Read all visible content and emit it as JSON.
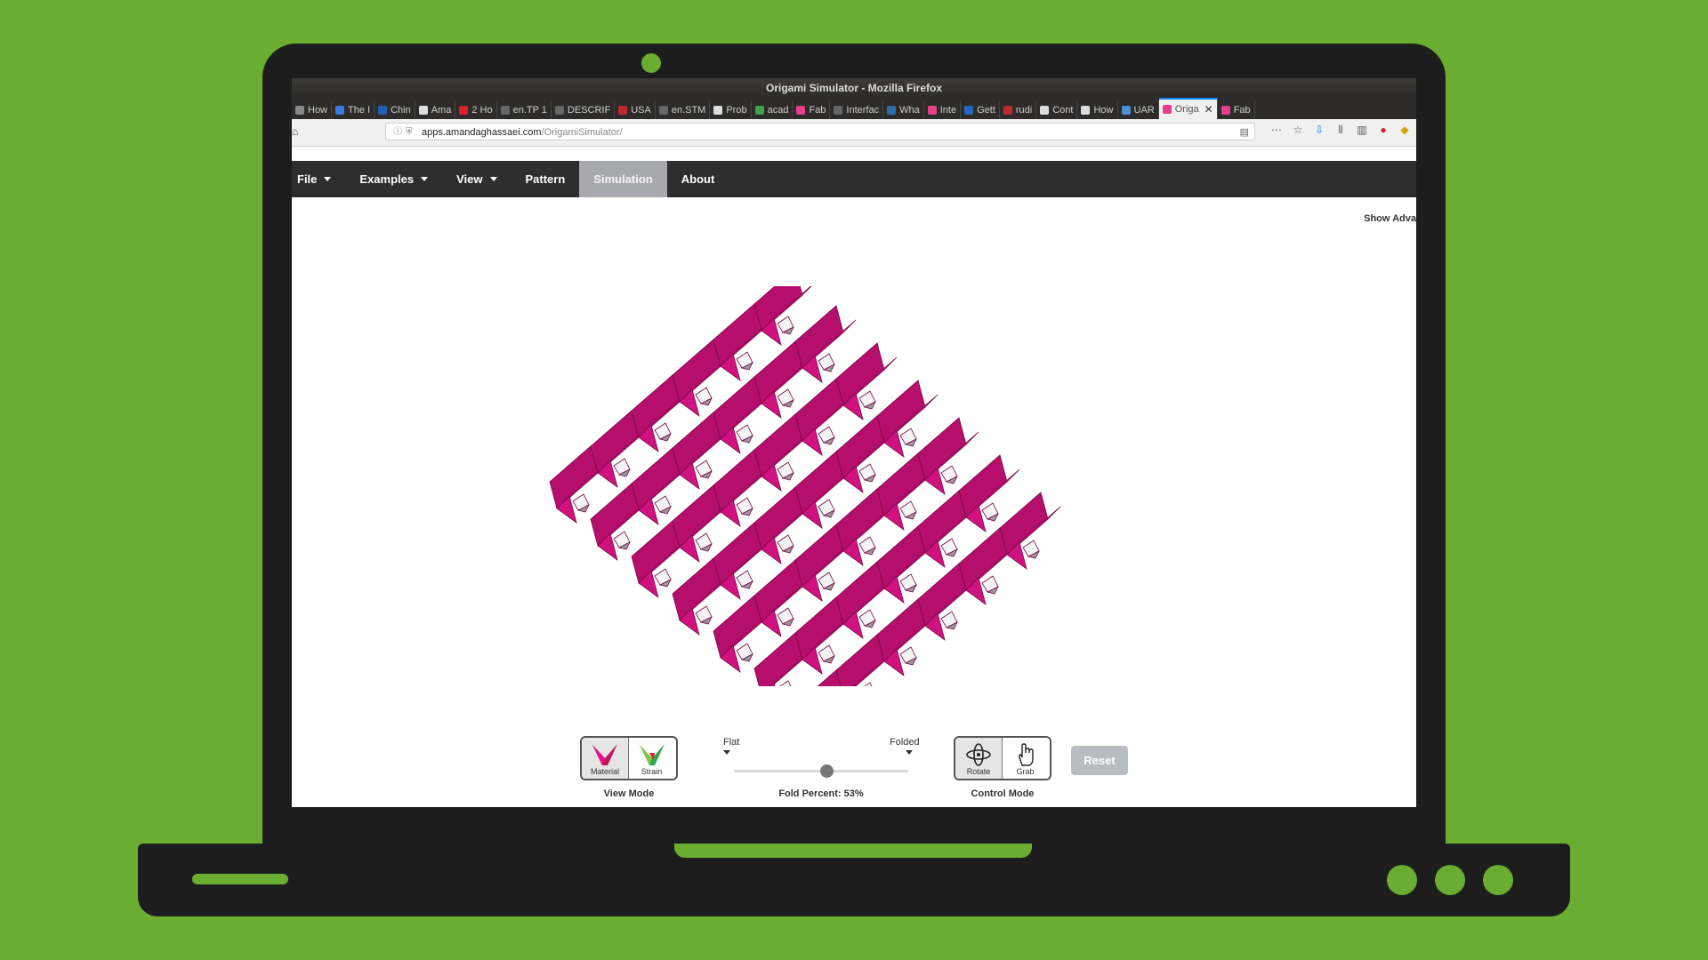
{
  "browser": {
    "window_title": "Origami Simulator - Mozilla Firefox",
    "tabs": [
      {
        "label": "How",
        "color": "#888888"
      },
      {
        "label": "The I",
        "color": "#3b7be0"
      },
      {
        "label": "Chin",
        "color": "#1c5fb5"
      },
      {
        "label": "Ama",
        "color": "#dddddd"
      },
      {
        "label": "2 Ho",
        "color": "#e02020"
      },
      {
        "label": "en.TP 1",
        "color": "#666666"
      },
      {
        "label": "DESCRIF",
        "color": "#666666"
      },
      {
        "label": "USA",
        "color": "#c0282d"
      },
      {
        "label": "en.STM",
        "color": "#666666"
      },
      {
        "label": "Prob",
        "color": "#dddddd"
      },
      {
        "label": "acad",
        "color": "#3fa34d"
      },
      {
        "label": "Fab",
        "color": "#e83e8c"
      },
      {
        "label": "Interfac",
        "color": "#666666"
      },
      {
        "label": "Wha",
        "color": "#2b6cb0"
      },
      {
        "label": "Inte",
        "color": "#e83e8c"
      },
      {
        "label": "Gett",
        "color": "#2166c1"
      },
      {
        "label": "rudi",
        "color": "#c0282d"
      },
      {
        "label": "Cont",
        "color": "#dddddd"
      },
      {
        "label": "How",
        "color": "#dddddd"
      },
      {
        "label": "UAR",
        "color": "#4a90d9"
      },
      {
        "label": "Origa",
        "color": "#e83e8c",
        "active": true
      },
      {
        "label": "Fab",
        "color": "#e83e8c"
      }
    ],
    "url_domain": "apps.amandaghassaei.com",
    "url_path": "/OrigamiSimulator/"
  },
  "menu": {
    "file": "File",
    "examples": "Examples",
    "view": "View",
    "pattern": "Pattern",
    "simulation": "Simulation",
    "about": "About"
  },
  "show_advanced": "Show Adva",
  "controls": {
    "view_mode": {
      "label": "View Mode",
      "material": "Material",
      "strain": "Strain",
      "selected": "Material"
    },
    "fold": {
      "flat": "Flat",
      "folded": "Folded",
      "percent_label": "Fold Percent: 53%",
      "percent": 53
    },
    "control_mode": {
      "label": "Control Mode",
      "rotate": "Rotate",
      "grab": "Grab",
      "selected": "Rotate"
    },
    "reset": "Reset"
  },
  "colors": {
    "accent_pink": "#e8118a",
    "menu_bg": "#2e2e2e",
    "menu_active": "#a7a9ad",
    "background_green": "#6aae31"
  }
}
